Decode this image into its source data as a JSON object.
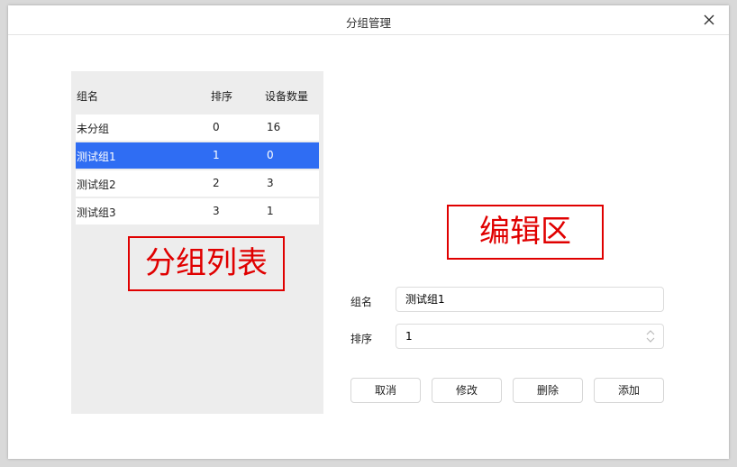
{
  "dialog": {
    "title": "分组管理"
  },
  "table": {
    "headers": [
      "组名",
      "排序",
      "设备数量"
    ],
    "rows": [
      {
        "name": "未分组",
        "order": "0",
        "count": "16"
      },
      {
        "name": "测试组1",
        "order": "1",
        "count": "0"
      },
      {
        "name": "测试组2",
        "order": "2",
        "count": "3"
      },
      {
        "name": "测试组3",
        "order": "3",
        "count": "1"
      }
    ],
    "selected_index": 1
  },
  "annotations": {
    "list": "分组列表",
    "edit": "编辑区"
  },
  "form": {
    "name_label": "组名",
    "name_value": "测试组1",
    "order_label": "排序",
    "order_value": "1"
  },
  "buttons": {
    "cancel": "取消",
    "modify": "修改",
    "delete": "删除",
    "add": "添加"
  },
  "colors": {
    "selected_row": "#2f6df3",
    "annotation": "#e00000",
    "panel_bg": "#ededed"
  }
}
